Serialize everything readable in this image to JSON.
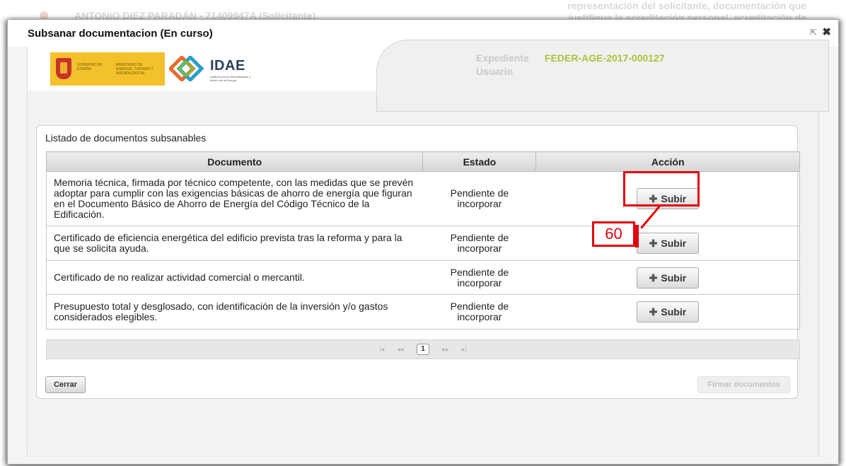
{
  "background": {
    "applicant_text": "ANTONIO DIEZ PARADÁN - 71409947A (Solicitante)",
    "right_text_line1": "representación del solicitante, documentación que",
    "right_text_line2": "justifique la acreditación personal, acreditación de"
  },
  "modal": {
    "title": "Subsanar documentacion (En curso)",
    "popout_icon": "popout-icon",
    "close_icon": "close-icon"
  },
  "banner": {
    "gov_text": "GOBIERNO DE ESPAÑA",
    "ministry_text": "MINISTERIO DE ENERGÍA, TURISMO Y AGENDA DIGITAL",
    "idae_logo": "IDAE",
    "idae_subtitle": "Instituto para la Diversificación y Ahorro de la Energía",
    "expediente_label": "Expediente",
    "expediente_value": "FEDER-AGE-2017-000127",
    "usuario_label": "Usuario"
  },
  "panel": {
    "title": "Listado de documentos subsanables",
    "columns": [
      "Documento",
      "Estado",
      "Acción"
    ],
    "rows": [
      {
        "documento": "Memoria técnica, firmada por técnico competente, con las medidas que se prevén adoptar para cumplir con las exigencias básicas de ahorro de energía que figuran en el Documento Básico de Ahorro de Energía del Código Técnico de la Edificación.",
        "estado_l1": "Pendiente de",
        "estado_l2": "incorporar",
        "accion": "Subir"
      },
      {
        "documento": "Certificado de eficiencia energética del edificio prevista tras la reforma y para la que se solicita ayuda.",
        "estado_l1": "Pendiente de",
        "estado_l2": "incorporar",
        "accion": "Subir"
      },
      {
        "documento": "Certificado de no realizar actividad comercial o mercantil.",
        "estado_l1": "Pendiente de",
        "estado_l2": "incorporar",
        "accion": "Subir"
      },
      {
        "documento": "Presupuesto total y desglosado, con identificación de la inversión y/o gastos considerados elegibles.",
        "estado_l1": "Pendiente de",
        "estado_l2": "incorporar",
        "accion": "Subir"
      }
    ],
    "pager": {
      "first": "⏮",
      "prev": "<<",
      "current_page": "1",
      "next": ">>",
      "last": "⏭"
    },
    "cerrar_label": "Cerrar",
    "firmar_label": "Firmar documentos"
  },
  "annotation": {
    "number": "60",
    "color": "#e4000f"
  }
}
